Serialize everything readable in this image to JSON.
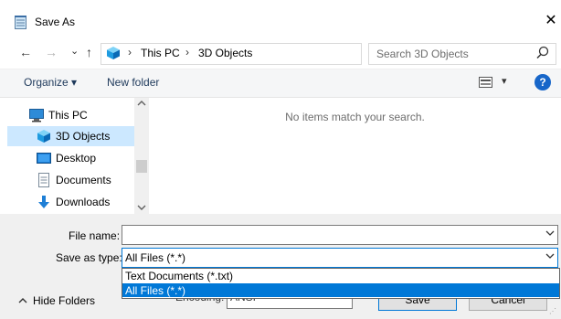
{
  "window": {
    "title": "Save As",
    "close_glyph": "✕"
  },
  "nav": {
    "back_glyph": "←",
    "forward_glyph": "→",
    "recent_glyph": "⌄",
    "up_glyph": "↑",
    "breadcrumb": [
      "This PC",
      "3D Objects"
    ],
    "separator": "›",
    "search_placeholder": "Search 3D Objects"
  },
  "toolbar": {
    "organize_label": "Organize ▾",
    "new_folder_label": "New folder",
    "view_glyph": "▾",
    "help_glyph": "?"
  },
  "tree": {
    "items": [
      {
        "label": "This PC",
        "icon": "computer-icon"
      },
      {
        "label": "3D Objects",
        "icon": "3d-objects-icon",
        "selected": true
      },
      {
        "label": "Desktop",
        "icon": "desktop-icon"
      },
      {
        "label": "Documents",
        "icon": "documents-icon"
      },
      {
        "label": "Downloads",
        "icon": "downloads-icon"
      }
    ]
  },
  "content": {
    "empty_message": "No items match your search."
  },
  "form": {
    "file_name_label": "File name:",
    "file_name_value": "",
    "save_type_label": "Save as type:",
    "save_type_value": "All Files  (*.*)",
    "options": [
      "Text Documents (*.txt)",
      "All Files  (*.*)"
    ],
    "highlighted_option": 1,
    "encoding_label": "Encoding:",
    "encoding_value": "ANSI",
    "save_label": "Save",
    "cancel_label": "Cancel",
    "hide_folders_label": "Hide Folders"
  },
  "colors": {
    "accent": "#0078d7",
    "selected_bg": "#cce8ff",
    "help_blue": "#1766c9"
  }
}
